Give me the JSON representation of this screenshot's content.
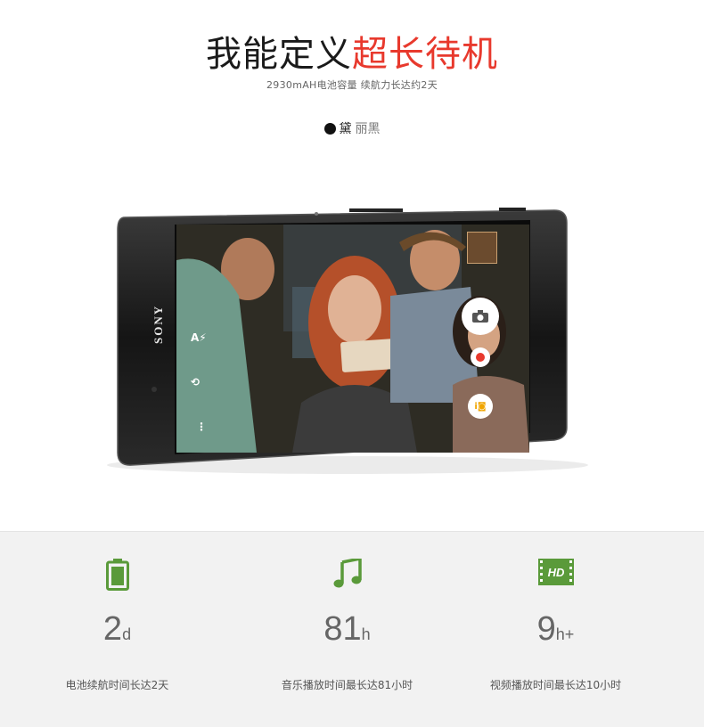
{
  "hero": {
    "title_dark": "我能定义",
    "title_red": "超长待机",
    "subtitle": "2930mAH电池容量 续航力长达约2天"
  },
  "color_option": {
    "label_dark": "黛",
    "label_light": "丽黑"
  },
  "phone": {
    "brand": "SONY"
  },
  "stats": [
    {
      "value": "2",
      "unit": "d",
      "label": "电池续航时间长达2天",
      "icon": "battery-icon"
    },
    {
      "value": "81",
      "unit": "h",
      "label": "音乐播放时间最长达81小时",
      "icon": "music-note-icon"
    },
    {
      "value": "9",
      "unit": "h+",
      "label": "视频播放时间最长达10小时",
      "icon": "hd-video-icon"
    }
  ],
  "colors": {
    "accent_red": "#e8392d",
    "icon_green": "#5a9a3a"
  }
}
